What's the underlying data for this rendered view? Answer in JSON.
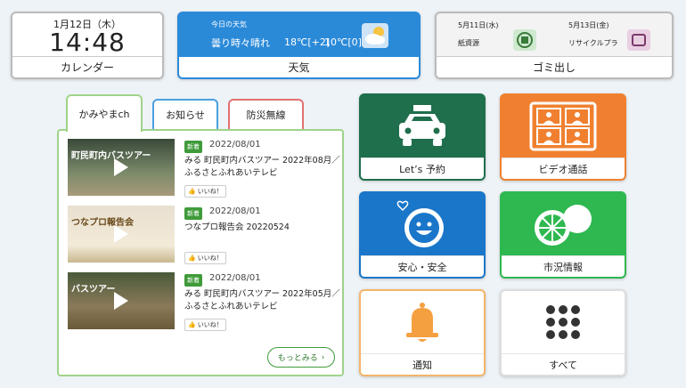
{
  "calendar": {
    "date": "1月12日（木）",
    "time": "14:48",
    "label": "カレンダー"
  },
  "weather": {
    "heading": "今日の天気",
    "condition": "曇り時々晴れ",
    "high": "18℃[+2]",
    "low": "10℃[0]",
    "label": "天気"
  },
  "garbage": {
    "label": "ゴミ出し",
    "items": [
      {
        "date": "5月11日(水)",
        "type": "紙資源"
      },
      {
        "date": "5月13日(金)",
        "type": "リサイクルプラ"
      }
    ]
  },
  "tabs": [
    "かみやまch",
    "お知らせ",
    "防災無線"
  ],
  "videos": [
    {
      "badge": "新着",
      "date": "2022/08/01",
      "title": "みる 町民町内バスツアー 2022年08月／ふるさとふれあいテレビ",
      "like": "いいね！",
      "thumb_text": "町民町内バスツアー"
    },
    {
      "badge": "新着",
      "date": "2022/08/01",
      "title": "つなプロ報告会 20220524",
      "like": "いいね！",
      "thumb_text": "つなプロ報告会"
    },
    {
      "badge": "新着",
      "date": "2022/08/01",
      "title": "みる 町民町内バスツアー 2022年05月／ふるさとふれあいテレビ",
      "like": "いいね！",
      "thumb_text": "バスツアー"
    }
  ],
  "more_label": "もっとみる",
  "tiles": [
    {
      "label": "Let’s 予約"
    },
    {
      "label": "ビデオ通話"
    },
    {
      "label": "安心・安全"
    },
    {
      "label": "市況情報"
    },
    {
      "label": "通知"
    },
    {
      "label": "すべて"
    }
  ],
  "colors": {
    "accent_green": "#3f9b3a",
    "weather_blue": "#2b8ad8",
    "taxi_green": "#1f6e4c",
    "video_orange": "#f08030",
    "safety_blue": "#1a76c9",
    "market_green": "#2fb850"
  },
  "icons": {
    "weather": "cloud-sun-icon",
    "garbage_1": "paper-icon",
    "garbage_2": "plastic-icon",
    "taxi": "taxi-icon",
    "video": "video-call-icon",
    "safety": "smile-heart-icon",
    "market": "citrus-icon",
    "notice": "bell-icon",
    "all": "grid-icon"
  }
}
